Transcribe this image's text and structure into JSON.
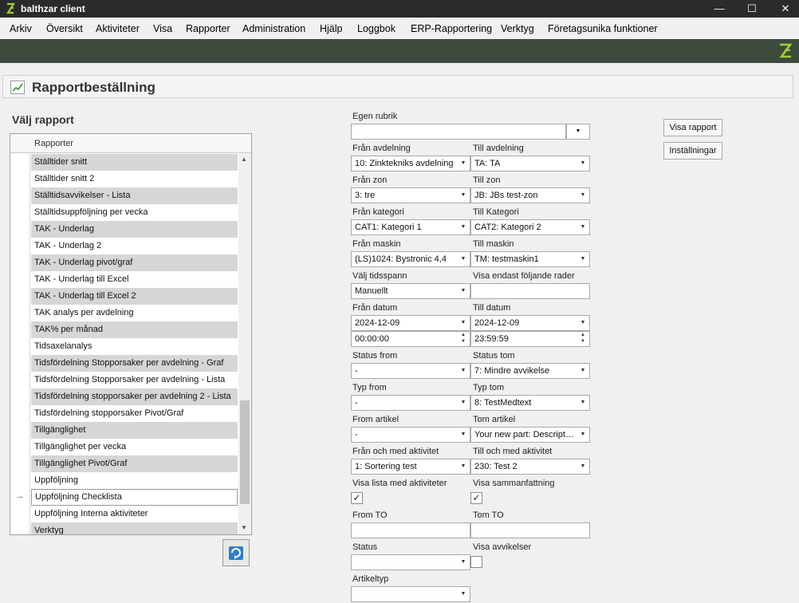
{
  "window": {
    "title": "balthzar client",
    "minimize": "—",
    "maximize": "☐",
    "close": "✕"
  },
  "menu": [
    "Arkiv",
    "Översikt",
    "Aktiviteter",
    "Visa",
    "Rapporter",
    "Administration",
    "Hjälp",
    "Loggbok",
    "ERP-Rapportering",
    "Verktyg",
    "Företagsunika funktioner"
  ],
  "page": {
    "title": "Rapportbeställning"
  },
  "report_list": {
    "section_title": "Välj rapport",
    "column_header": "Rapporter",
    "selected_index": 20,
    "rows": [
      "Ställtider snitt",
      "Ställtider snitt 2",
      "Ställtidsavvikelser - Lista",
      "Ställtidsuppföljning per vecka",
      "TAK - Underlag",
      "TAK - Underlag 2",
      "TAK - Underlag pivot/graf",
      "TAK - Underlag till Excel",
      "TAK - Underlag till Excel 2",
      "TAK analys per avdelning",
      "TAK% per månad",
      "Tidsaxelanalys",
      "Tidsfördelning Stopporsaker per avdelning - Graf",
      "Tidsfördelning Stopporsaker per avdelning - Lista",
      "Tidsfördelning stopporsaker per avdelning 2 - Lista",
      "Tidsfördelning stopporsaker Pivot/Graf",
      "Tillgänglighet",
      "Tillgänglighet per vecka",
      "Tillgänglighet Pivot/Graf",
      "Uppföljning",
      "Uppföljning Checklista",
      "Uppföljning Interna aktiviteter",
      "Verktyg"
    ]
  },
  "form": {
    "egen_rubrik": {
      "label": "Egen rubrik",
      "value": ""
    },
    "fran_avdelning": {
      "label": "Från avdelning",
      "value": "10: Zinktekniks avdelning"
    },
    "till_avdelning": {
      "label": "Till avdelning",
      "value": "TA: TA"
    },
    "fran_zon": {
      "label": "Från zon",
      "value": "3: tre"
    },
    "till_zon": {
      "label": "Till zon",
      "value": "JB: JBs test-zon"
    },
    "fran_kategori": {
      "label": "Från kategori",
      "value": "CAT1: Kategori 1"
    },
    "till_kategori": {
      "label": "Till Kategori",
      "value": "CAT2: Kategori 2"
    },
    "fran_maskin": {
      "label": "Från maskin",
      "value": "(LS)1024: Bystronic 4,4"
    },
    "till_maskin": {
      "label": "Till maskin",
      "value": "TM: testmaskin1"
    },
    "valj_tidsspann": {
      "label": "Välj tidsspann",
      "value": "Manuellt"
    },
    "visa_endast": {
      "label": "Visa endast följande rader",
      "value": ""
    },
    "fran_datum": {
      "label": "Från datum",
      "date": "2024-12-09",
      "time": "00:00:00"
    },
    "till_datum": {
      "label": "Till datum",
      "date": "2024-12-09",
      "time": "23:59:59"
    },
    "status_from": {
      "label": "Status from",
      "value": "-"
    },
    "status_tom": {
      "label": "Status tom",
      "value": "7: Mindre avvikelse"
    },
    "typ_from": {
      "label": "Typ from",
      "value": "-"
    },
    "typ_tom": {
      "label": "Typ tom",
      "value": "8: TestMedtext"
    },
    "from_artikel": {
      "label": "From artikel",
      "value": "-"
    },
    "tom_artikel": {
      "label": "Tom artikel",
      "value": "Your new part: Description"
    },
    "fran_aktivitet": {
      "label": "Från och med aktivitet",
      "value": "1: Sortering test"
    },
    "till_aktivitet": {
      "label": "Till och med aktivitet",
      "value": "230: Test 2"
    },
    "visa_lista": {
      "label": "Visa lista med aktiviteter",
      "mark": "✓"
    },
    "visa_sammanfattning": {
      "label": "Visa sammanfattning",
      "mark": "✓"
    },
    "from_to": {
      "label": "From TO",
      "value": ""
    },
    "tom_to": {
      "label": "Tom TO",
      "value": ""
    },
    "status": {
      "label": "Status",
      "value": ""
    },
    "visa_avvikelser": {
      "label": "Visa avvikelser",
      "mark": ""
    },
    "artikeltyp": {
      "label": "Artikeltyp",
      "value": ""
    }
  },
  "buttons": {
    "visa_rapport": "Visa rapport",
    "installningar": "Inställningar"
  },
  "icons": {
    "arrow": "→",
    "dropdown": "▼",
    "spin_up": "▲",
    "spin_down": "▼"
  },
  "colors": {
    "titlebar": "#2b2b2b",
    "band": "#3d4a3e",
    "accent": "#9fcf3a",
    "row_alt": "#d6d6d6"
  }
}
